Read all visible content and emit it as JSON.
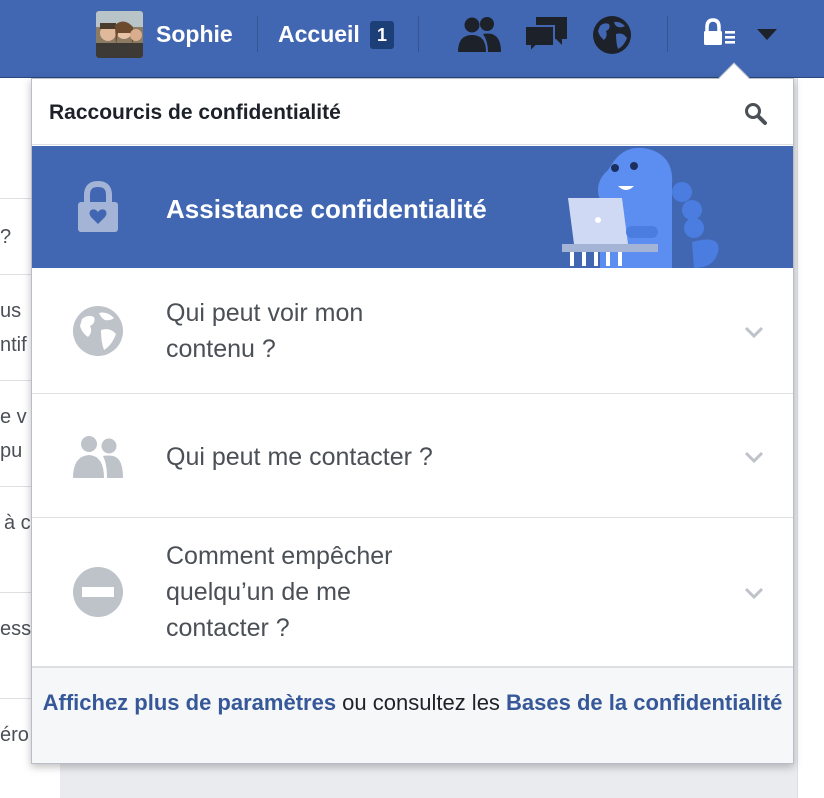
{
  "topbar": {
    "user_name": "Sophie",
    "home_label": "Accueil",
    "home_badge": "1",
    "icons": [
      "friends-icon",
      "messages-icon",
      "globe-notifications-icon",
      "privacy-shortcuts-icon",
      "account-menu-caret-icon"
    ],
    "background_color": "#4267b2"
  },
  "background_fragments": [
    "?",
    "us",
    "ntif",
    "e v",
    "pu",
    "à c",
    "ess",
    "éro"
  ],
  "dropdown": {
    "title": "Raccourcis de confidentialité",
    "search_icon": "search-icon",
    "assistance": {
      "label": "Assistance confidentialité",
      "icon": "lock-heart-icon",
      "illustration": "dinosaur-laptop-illustration"
    },
    "items": [
      {
        "lines": [
          "Qui peut voir mon",
          "contenu ?"
        ],
        "icon": "globe-icon"
      },
      {
        "lines": [
          "Qui peut me contacter ?"
        ],
        "icon": "people-icon"
      },
      {
        "lines": [
          "Comment empêcher",
          "quelqu’un de me",
          "contacter ?"
        ],
        "icon": "block-icon"
      }
    ],
    "footer": {
      "link1": "Affichez plus de paramètres",
      "middle": " ou consultez les ",
      "link2": "Bases de la confidentialité"
    }
  },
  "colors": {
    "brand": "#4267b2",
    "link": "#365899",
    "icon_gray": "#bec2c9"
  }
}
